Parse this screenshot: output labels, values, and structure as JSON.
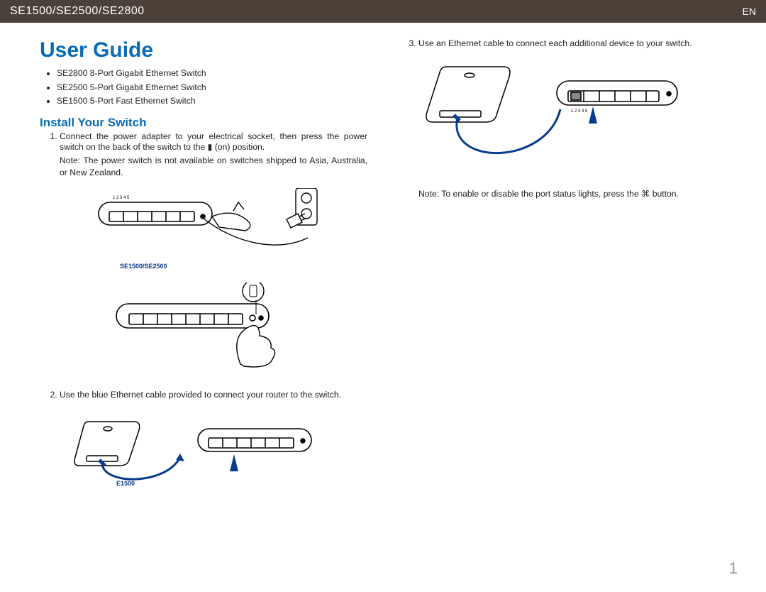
{
  "header": {
    "title": "SE1500/SE2500/SE2800",
    "lang": "EN"
  },
  "main_title": "User Guide",
  "models": [
    "SE2800 8-Port Gigabit Ethernet Switch",
    "SE2500 5-Port Gigabit Ethernet Switch",
    "SE1500 5-Port Fast Ethernet Switch"
  ],
  "section_title": "Install Your Switch",
  "steps": {
    "s1": "Connect the power adapter to your electrical socket, then press the power switch on the back of the switch to the ▮ (on) position.",
    "s1_note": "Note: The power switch is not available on switches shipped to Asia, Australia, or New Zealand.",
    "s2": "Use the blue Ethernet cable provided to connect your router to the switch.",
    "s3": "Use an Ethernet cable to connect each additional device to your switch."
  },
  "labels": {
    "fig1": "SE1500/SE2500",
    "fig2": "E1500"
  },
  "right_note": "Note: To enable or disable the port status lights, press the ⌘ button.",
  "page_number": "1"
}
